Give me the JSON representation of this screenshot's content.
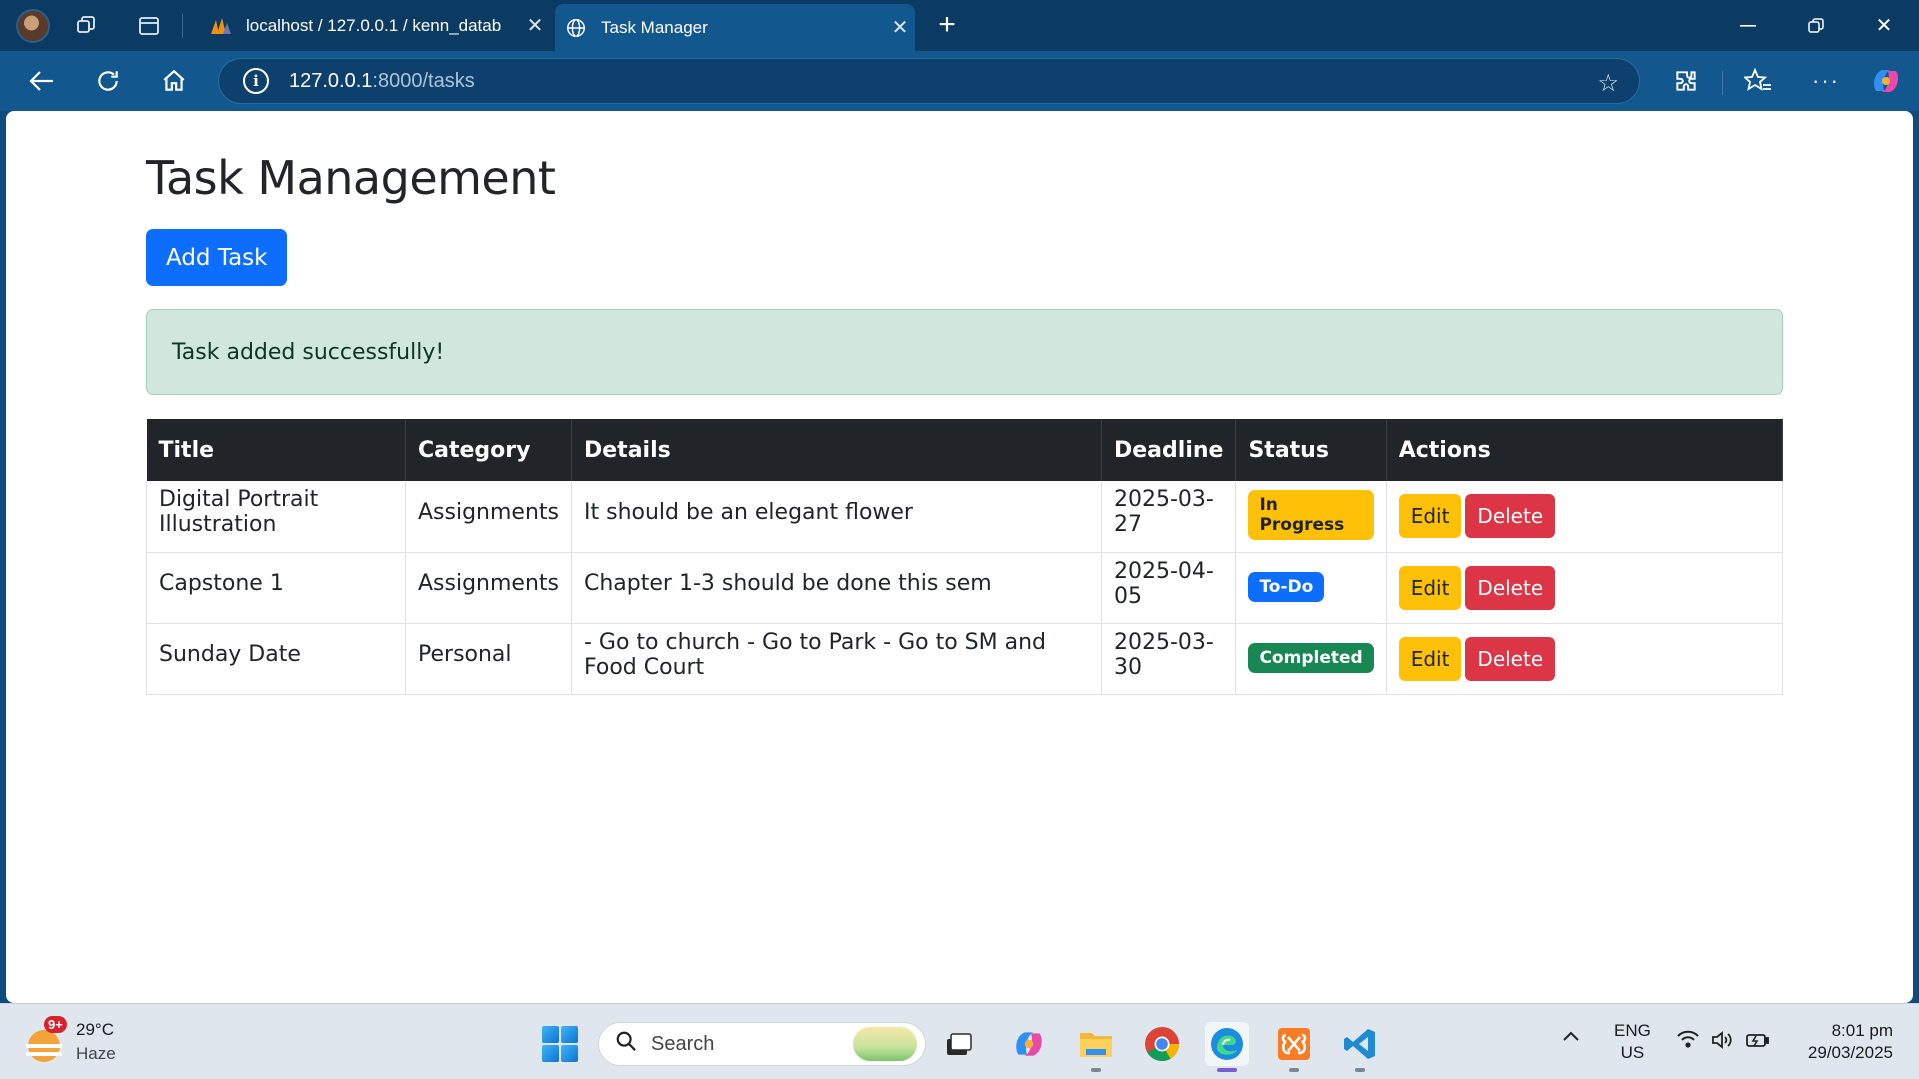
{
  "browser": {
    "tabs": [
      {
        "title": "localhost / 127.0.0.1 / kenn_datab",
        "active": false
      },
      {
        "title": "Task Manager",
        "active": true
      }
    ],
    "url_host": "127.0.0.1",
    "url_rest": ":8000/tasks"
  },
  "page": {
    "heading": "Task Management",
    "add_button": "Add Task",
    "alert": "Task added successfully!",
    "table": {
      "headers": [
        "Title",
        "Category",
        "Details",
        "Deadline",
        "Status",
        "Actions"
      ],
      "rows": [
        {
          "title": "Digital Portrait Illustration",
          "category": "Assignments",
          "details": "It should be an elegant flower",
          "deadline": "2025-03-27",
          "status": "In Progress"
        },
        {
          "title": "Capstone 1",
          "category": "Assignments",
          "details": "Chapter 1-3 should be done this sem",
          "deadline": "2025-04-05",
          "status": "To-Do"
        },
        {
          "title": "Sunday Date",
          "category": "Personal",
          "details": "- Go to church - Go to Park - Go to SM and Food Court",
          "deadline": "2025-03-30",
          "status": "Completed"
        }
      ],
      "edit_label": "Edit",
      "delete_label": "Delete"
    }
  },
  "colors": {
    "primary": "#0d6efd",
    "warning": "#ffc107",
    "danger": "#dc3545",
    "success": "#198754",
    "alert_bg": "#d1e7dd",
    "table_header": "#212529"
  },
  "taskbar": {
    "weather_temp": "29°C",
    "weather_desc": "Haze",
    "weather_badge": "9+",
    "search_placeholder": "Search",
    "lang_1": "ENG",
    "lang_2": "US",
    "time": "8:01 pm",
    "date": "29/03/2025"
  }
}
